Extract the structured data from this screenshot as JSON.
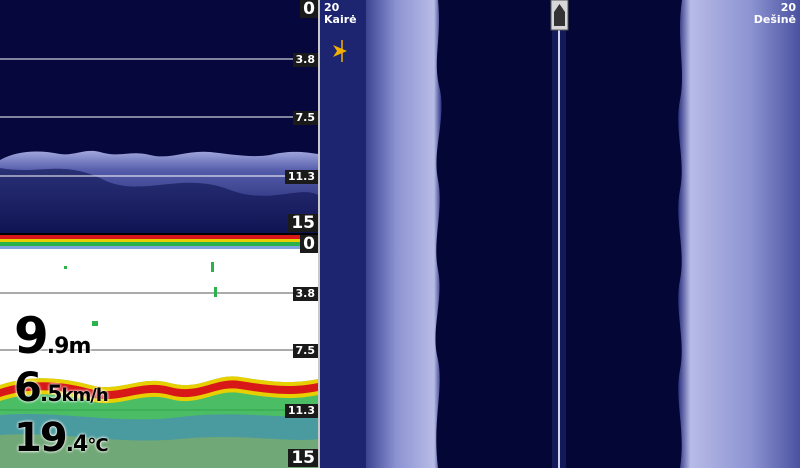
{
  "down_view": {
    "scale_labels": [
      "0",
      "3.8",
      "7.5",
      "11.3",
      "15"
    ]
  },
  "sonar_2d": {
    "scale_labels": [
      "0",
      "3.8",
      "7.5",
      "11.3",
      "15"
    ]
  },
  "readouts": {
    "depth": {
      "value_main": "9",
      "value_decimal": ".9",
      "unit": "m"
    },
    "speed": {
      "value_main": "6",
      "value_decimal": ".5",
      "unit": "km/h"
    },
    "temperature": {
      "value_main": "19",
      "value_decimal": ".4",
      "unit": "°C"
    }
  },
  "side_view": {
    "left": {
      "range": "20",
      "label": "Kairė"
    },
    "right": {
      "range": "20",
      "label": "Dešinė"
    }
  },
  "colors": {
    "down_bg": "#06083d",
    "side_bg": "#040635",
    "sonar_bg": "#ffffff",
    "bottom_red": "#d81818",
    "bottom_yellow": "#e8d000",
    "bottom_green": "#2bb24a",
    "cursor": "#f2b000"
  }
}
